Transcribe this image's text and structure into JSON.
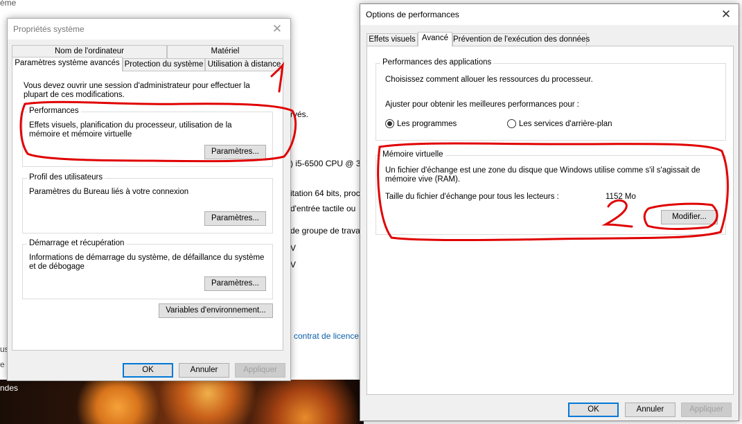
{
  "background": {
    "frag_top": "ème",
    "frag_server": "rvés.",
    "frag_cpu": ") i5-6500 CPU @ 3.",
    "frag_os": "itation 64 bits, proc",
    "frag_touch": "d'entrée tactile ou",
    "frag_workgroup": "de groupe de trava",
    "frag_v1": "V",
    "frag_v2": "V",
    "frag_license": "contrat de licence",
    "frag_left_us": "us",
    "frag_left_e": "e",
    "frag_left_ndes": "ndes"
  },
  "sysprops": {
    "title": "Propriétés système",
    "tabs_row1": [
      "Nom de l'ordinateur",
      "Matériel"
    ],
    "tabs_row2": [
      "Paramètres système avancés",
      "Protection du système",
      "Utilisation à distance"
    ],
    "admin_note": "Vous devez ouvrir une session d'administrateur pour effectuer la plupart de ces modifications.",
    "performances": {
      "label": "Performances",
      "desc": "Effets visuels, planification du processeur, utilisation de la mémoire et mémoire virtuelle",
      "button": "Paramètres..."
    },
    "profil": {
      "label": "Profil des utilisateurs",
      "desc": "Paramètres du Bureau liés à votre connexion",
      "button": "Paramètres..."
    },
    "demarrage": {
      "label": "Démarrage et récupération",
      "desc": "Informations de démarrage du système, de défaillance du système et de débogage",
      "button": "Paramètres..."
    },
    "env_button": "Variables d'environnement...",
    "ok": "OK",
    "cancel": "Annuler",
    "apply": "Appliquer"
  },
  "perfopts": {
    "title": "Options de performances",
    "tabs": [
      "Effets visuels",
      "Avancé",
      "Prévention de l'exécution des données"
    ],
    "app_perf": {
      "label": "Performances des applications",
      "desc": "Choisissez comment allouer les ressources du processeur.",
      "adjust": "Ajuster pour obtenir les meilleures performances pour :",
      "radio_programs": "Les programmes",
      "radio_services": "Les services d'arrière-plan",
      "selected": "Les programmes"
    },
    "vm": {
      "label": "Mémoire virtuelle",
      "desc": "Un fichier d'échange est une zone du disque que Windows utilise comme s'il s'agissait de mémoire vive (RAM).",
      "size_label": "Taille du fichier d'échange pour tous les lecteurs :",
      "size_value": "1152 Mo",
      "button": "Modifier..."
    },
    "ok": "OK",
    "cancel": "Annuler",
    "apply": "Appliquer"
  },
  "annotations": {
    "colors": {
      "ink": "#e00000"
    },
    "number_1": "1",
    "number_2": "2"
  }
}
